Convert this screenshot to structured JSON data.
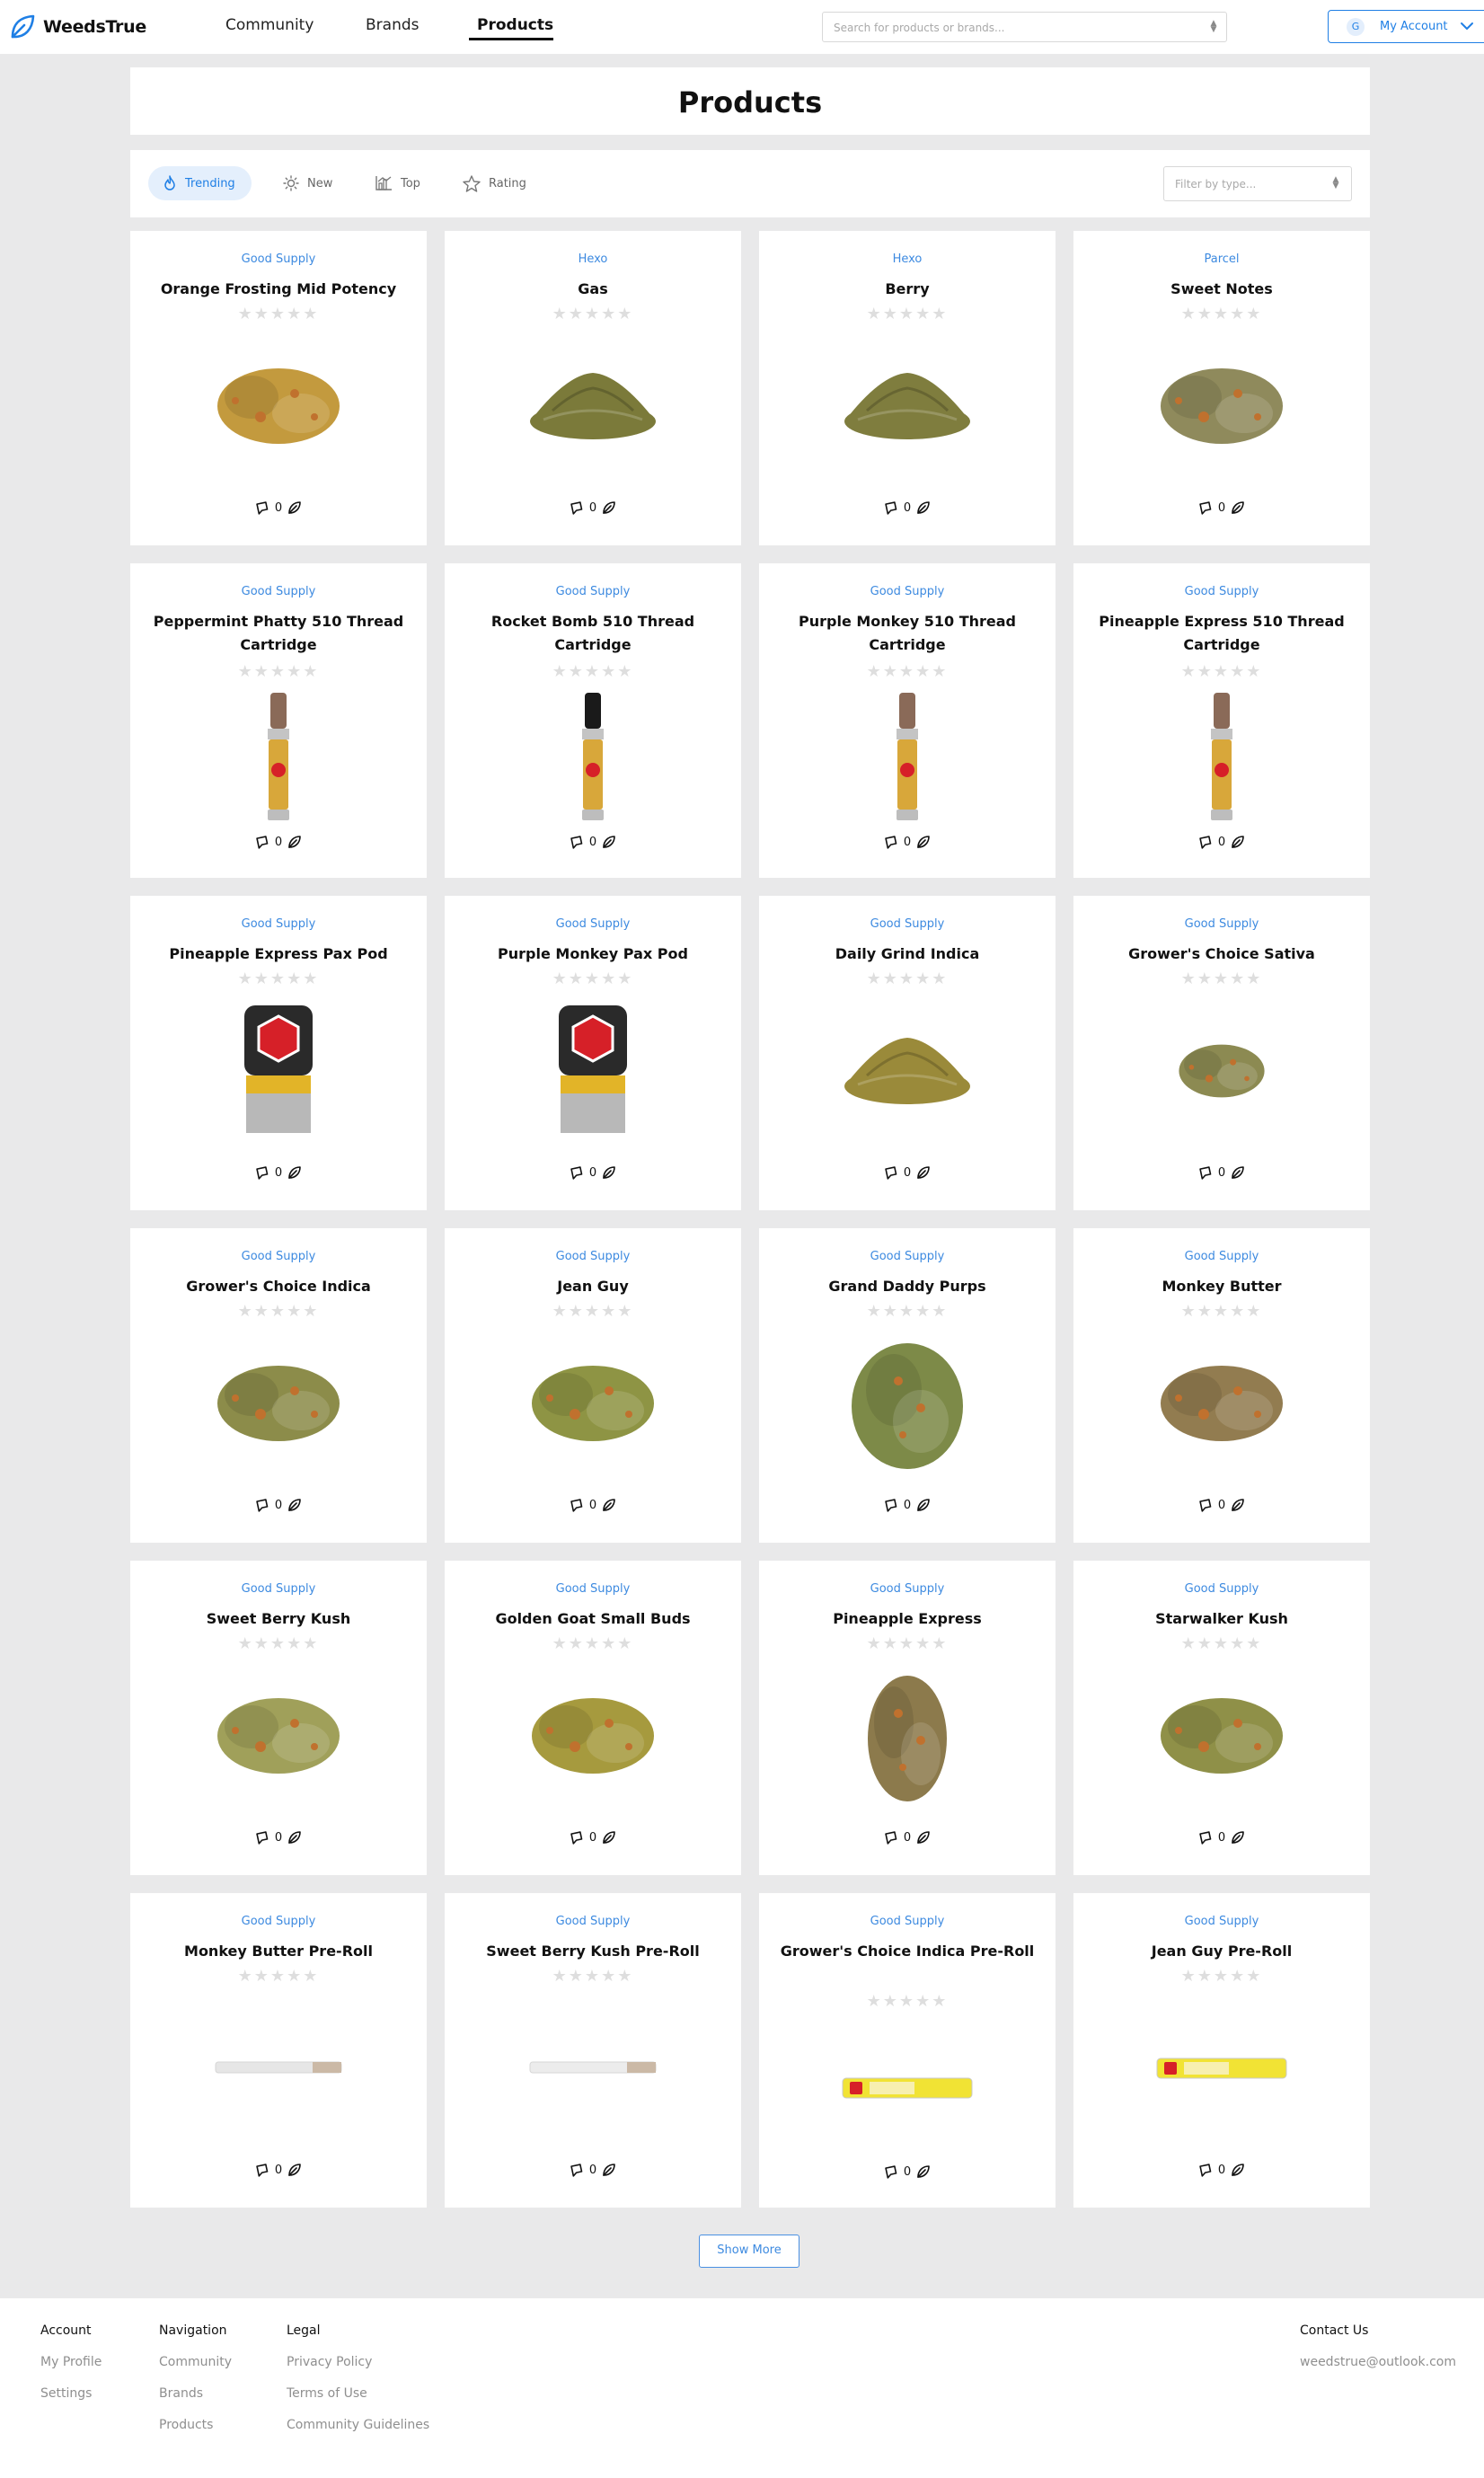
{
  "header": {
    "logo_text": "WeedsTrue",
    "nav": [
      "Community",
      "Brands",
      "Products"
    ],
    "search_placeholder": "Search for products or brands...",
    "account": {
      "avatar_initial": "G",
      "label": "My Account"
    }
  },
  "page": {
    "title": "Products"
  },
  "filters": {
    "tabs": [
      {
        "label": "Trending",
        "icon": "flame-icon"
      },
      {
        "label": "New",
        "icon": "sun-icon"
      },
      {
        "label": "Top",
        "icon": "bar-chart-icon"
      },
      {
        "label": "Rating",
        "icon": "star-icon"
      }
    ],
    "type_placeholder": "Filter by type..."
  },
  "products": [
    {
      "brand": "Good Supply",
      "name": "Orange Frosting Mid Potency",
      "comments": "0",
      "kind": "flower",
      "color": "#c39a3e"
    },
    {
      "brand": "Hexo",
      "name": "Gas",
      "comments": "0",
      "kind": "ground",
      "color": "#7b7a3a"
    },
    {
      "brand": "Hexo",
      "name": "Berry",
      "comments": "0",
      "kind": "ground",
      "color": "#7f7d3e"
    },
    {
      "brand": "Parcel",
      "name": "Sweet Notes",
      "comments": "0",
      "kind": "flower",
      "color": "#8f8a5c"
    },
    {
      "brand": "Good Supply",
      "name": "Peppermint Phatty 510 Thread Cartridge",
      "comments": "0",
      "kind": "cartridge",
      "color": "#8a6a58"
    },
    {
      "brand": "Good Supply",
      "name": "Rocket Bomb 510 Thread Cartridge",
      "comments": "0",
      "kind": "cartridge",
      "color": "#1a1a1a"
    },
    {
      "brand": "Good Supply",
      "name": "Purple Monkey 510 Thread Cartridge",
      "comments": "0",
      "kind": "cartridge",
      "color": "#8a6a58"
    },
    {
      "brand": "Good Supply",
      "name": "Pineapple Express 510 Thread Cartridge",
      "comments": "0",
      "kind": "cartridge",
      "color": "#8a6a58"
    },
    {
      "brand": "Good Supply",
      "name": "Pineapple Express Pax Pod",
      "comments": "0",
      "kind": "pod",
      "color": "#d62028"
    },
    {
      "brand": "Good Supply",
      "name": "Purple Monkey Pax Pod",
      "comments": "0",
      "kind": "pod",
      "color": "#d62028"
    },
    {
      "brand": "Good Supply",
      "name": "Daily Grind Indica",
      "comments": "0",
      "kind": "ground",
      "color": "#9a8a3a"
    },
    {
      "brand": "Good Supply",
      "name": "Grower's Choice Sativa",
      "comments": "0",
      "kind": "flower-small",
      "color": "#8c8a52"
    },
    {
      "brand": "Good Supply",
      "name": "Grower's Choice Indica",
      "comments": "0",
      "kind": "flower",
      "color": "#8c8c4a"
    },
    {
      "brand": "Good Supply",
      "name": "Jean Guy",
      "comments": "0",
      "kind": "flower",
      "color": "#8e9444"
    },
    {
      "brand": "Good Supply",
      "name": "Grand Daddy Purps",
      "comments": "0",
      "kind": "flower-big",
      "color": "#7d8a48"
    },
    {
      "brand": "Good Supply",
      "name": "Monkey Butter",
      "comments": "0",
      "kind": "flower",
      "color": "#927c50"
    },
    {
      "brand": "Good Supply",
      "name": "Sweet Berry Kush",
      "comments": "0",
      "kind": "flower",
      "color": "#a0a05a"
    },
    {
      "brand": "Good Supply",
      "name": "Golden Goat Small Buds",
      "comments": "0",
      "kind": "flower",
      "color": "#a69a3e"
    },
    {
      "brand": "Good Supply",
      "name": "Pineapple Express",
      "comments": "0",
      "kind": "flower-tall",
      "color": "#8c7a4c"
    },
    {
      "brand": "Good Supply",
      "name": "Starwalker Kush",
      "comments": "0",
      "kind": "flower",
      "color": "#8f9048"
    },
    {
      "brand": "Good Supply",
      "name": "Monkey Butter Pre-Roll",
      "comments": "0",
      "kind": "preroll",
      "color": "#e6e6e6"
    },
    {
      "brand": "Good Supply",
      "name": "Sweet Berry Kush Pre-Roll",
      "comments": "0",
      "kind": "preroll",
      "color": "#ececec"
    },
    {
      "brand": "Good Supply",
      "name": "Grower's Choice Indica Pre-Roll",
      "comments": "0",
      "kind": "tube",
      "color": "#f1e334"
    },
    {
      "brand": "Good Supply",
      "name": "Jean Guy Pre-Roll",
      "comments": "0",
      "kind": "tube",
      "color": "#f1e334"
    }
  ],
  "show_more": "Show More",
  "footer": {
    "account": {
      "title": "Account",
      "links": [
        "My Profile",
        "Settings"
      ]
    },
    "navigation": {
      "title": "Navigation",
      "links": [
        "Community",
        "Brands",
        "Products"
      ]
    },
    "legal": {
      "title": "Legal",
      "links": [
        "Privacy Policy",
        "Terms of Use",
        "Community Guidelines"
      ]
    },
    "contact": {
      "title": "Contact Us",
      "email": "weedstrue@outlook.com"
    }
  }
}
